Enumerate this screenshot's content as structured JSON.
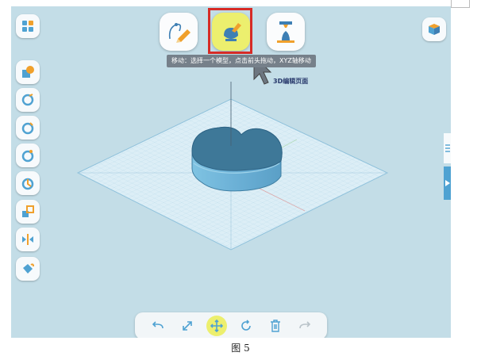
{
  "toolbar": {
    "tooltip": "移动：选择一个模型，点击前头拖动，XYZ轴移动",
    "sketch_icon": "sketch-pen-icon",
    "edit3d_icon": "3d-edit-icon",
    "print_icon": "3d-print-icon"
  },
  "annotation": {
    "label": "3D编辑页面"
  },
  "bottom_bar": {
    "undo_icon": "undo-icon",
    "scale_icon": "scale-arrows-icon",
    "move_icon": "move-cross-icon",
    "rotate_icon": "rotate-icon",
    "delete_icon": "trash-icon",
    "redo_icon": "redo-icon"
  },
  "caption": "图 5",
  "colors": {
    "canvas": "#c3dde7",
    "accent_yellow": "#ecef6e",
    "highlight_red": "#d62b26",
    "model_blue": "#4a86a8"
  }
}
